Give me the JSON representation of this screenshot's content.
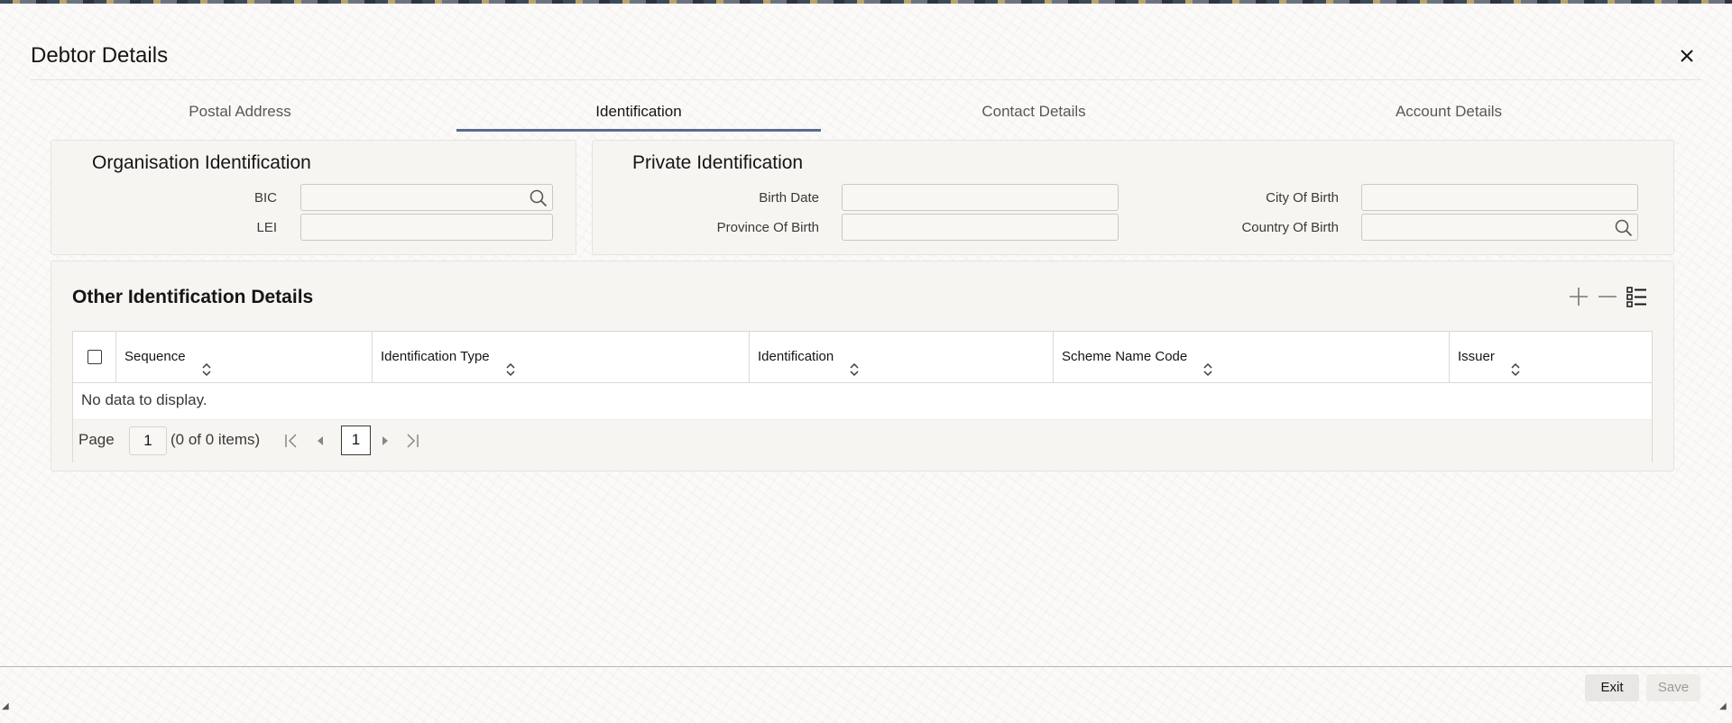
{
  "dialog": {
    "title": "Debtor Details",
    "close_icon": "close-icon"
  },
  "tabs": [
    {
      "label": "Postal Address",
      "active": false
    },
    {
      "label": "Identification",
      "active": true
    },
    {
      "label": "Contact Details",
      "active": false
    },
    {
      "label": "Account Details",
      "active": false
    }
  ],
  "organisation": {
    "title": "Organisation Identification",
    "bic_label": "BIC",
    "bic_value": "",
    "lei_label": "LEI",
    "lei_value": ""
  },
  "private": {
    "title": "Private Identification",
    "birth_date_label": "Birth Date",
    "birth_date_value": "",
    "province_label": "Province Of Birth",
    "province_value": "",
    "city_label": "City Of Birth",
    "city_value": "",
    "country_label": "Country Of Birth",
    "country_value": ""
  },
  "other": {
    "title": "Other Identification Details",
    "tools": [
      "add-icon",
      "remove-icon",
      "list-view-icon"
    ],
    "columns": [
      "Sequence",
      "Identification Type",
      "Identification",
      "Scheme Name Code",
      "Issuer"
    ],
    "rows": [],
    "empty_text": "No data to display.",
    "pager": {
      "page_label": "Page",
      "page_value": "1",
      "items_text": "(0 of 0 items)",
      "current_page": "1"
    }
  },
  "footer": {
    "exit_label": "Exit",
    "save_label": "Save"
  },
  "colors": {
    "accent": "#5b6b8c",
    "panel_bg": "#f6f5f2",
    "border": "#e6e3de"
  }
}
